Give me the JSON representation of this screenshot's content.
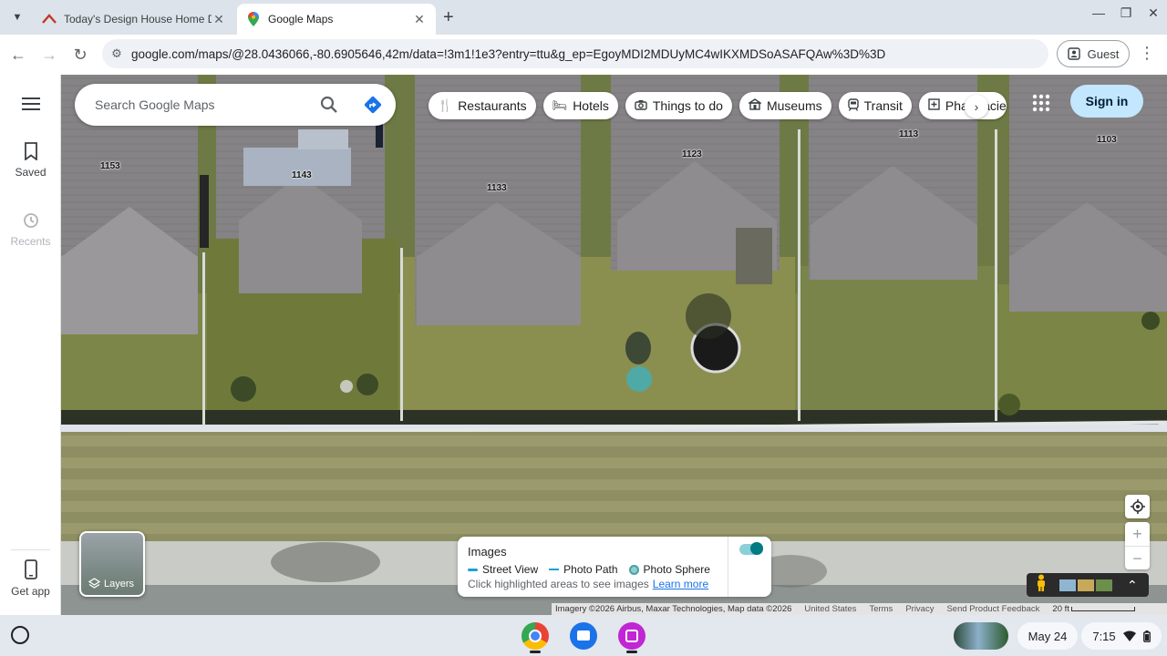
{
  "browser": {
    "tabs": [
      {
        "title": "Today's Design House Home D",
        "favicon": "house-icon",
        "active": false
      },
      {
        "title": "Google Maps",
        "favicon": "maps-pin-icon",
        "active": true
      }
    ],
    "new_tab_label": "+",
    "close_glyph": "✕",
    "url": "google.com/maps/@28.0436066,-80.6905646,42m/data=!3m1!1e3?entry=ttu&g_ep=EgoyMDI2MDUyMC4wIKXMDSoASAFQAw%3D%3D",
    "profile_label": "Guest"
  },
  "rail": {
    "saved_label": "Saved",
    "recents_label": "Recents",
    "get_app_label": "Get app"
  },
  "search": {
    "placeholder": "Search Google Maps"
  },
  "chips": [
    {
      "label": "Restaurants",
      "icon": "fork-knife-icon"
    },
    {
      "label": "Hotels",
      "icon": "bed-icon"
    },
    {
      "label": "Things to do",
      "icon": "camera-icon"
    },
    {
      "label": "Museums",
      "icon": "museum-icon"
    },
    {
      "label": "Transit",
      "icon": "train-icon"
    },
    {
      "label": "Pharmacies",
      "icon": "pharmacy-icon"
    }
  ],
  "sign_in_label": "Sign in",
  "house_numbers": [
    "1153",
    "1143",
    "1133",
    "1123",
    "1113",
    "1103"
  ],
  "layers_label": "Layers",
  "images_panel": {
    "title": "Images",
    "legend": [
      "Street View",
      "Photo Path",
      "Photo Sphere"
    ],
    "hint": "Click highlighted areas to see images",
    "learn_more": "Learn more",
    "toggle_on": true
  },
  "attribution": {
    "imagery": "Imagery ©2026 Airbus, Maxar Technologies, Map data ©2026",
    "country": "United States",
    "terms": "Terms",
    "privacy": "Privacy",
    "feedback": "Send Product Feedback",
    "scale": "20 ft"
  },
  "shelf": {
    "date": "May 24",
    "time": "7:15"
  },
  "colors": {
    "accent": "#1a73e8",
    "signin_bg": "#c2e7ff",
    "toggle": "#007b83"
  }
}
